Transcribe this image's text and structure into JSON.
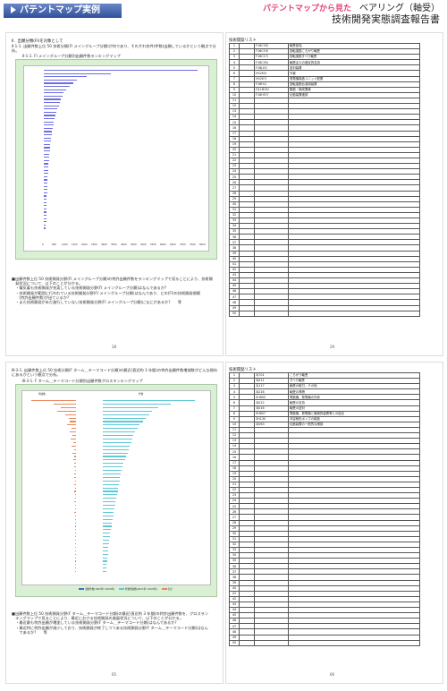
{
  "header": {
    "tag": "パテントマップ実例",
    "subtitle_pink": "パテントマップから見た",
    "subtitle_topic": "ベアリング（軸受）",
    "subtitle_report": "技術開発実態調査報告書"
  },
  "page1": {
    "heading": "Ⅱ．出願分類(FI)を対象として",
    "section": "Ⅱ-1-1. 出願件数上位 50 技術分類(FI メイングループ分類)が何であり、それぞれ何件(件数)出願しているかという観点で分析。",
    "chart_title": "Ⅱ-1-1. FI メイングループ分類別出願件数ランキングマップ",
    "body_lines": [
      "■出願件数上位 50 技術開発分野(FI メイングループ分類)の特許出願件数をランキングマップで見ることにより、技術開",
      "　発状況について、以下のことが分かる。",
      "　・電気着も技術開発が充実している技術開発分野(FI メイングループ分類)はなんであるか?",
      "　・技術開発が範囲に行われている技術開発分野(FI メイングループ分類)はなんであり、どの(FI)の技術開発規模",
      "　　(特許出願件数)が出ているか?",
      "　・また技術開発が未だ進行していない技術開発分野(FI メイングループ分類)になにがあるか?　　等"
    ],
    "page_number": "28"
  },
  "page2": {
    "table_title": "技術開発リスト",
    "rows": [
      [
        "1",
        "F16C33/",
        "軸受部品"
      ],
      [
        "2",
        "F16C19/",
        "回転運動ころがり軸受"
      ],
      [
        "3",
        "F16C17/",
        "回転運動すべり軸受"
      ],
      [
        "4",
        "F16C35/",
        "軸受またの固定的支持"
      ],
      [
        "5",
        "F16J15/",
        "密封装置"
      ],
      [
        "6",
        "H02K5/",
        "外被"
      ],
      [
        "7",
        "H02K7/",
        "発電機構造ユニット配置"
      ],
      [
        "8",
        "F16H1/",
        "回転運動伝達用装置"
      ],
      [
        "9",
        "G11B19/",
        "駆動・構成要素"
      ],
      [
        "10",
        "F16H57/",
        "伝動装置細部"
      ]
    ],
    "total_rows": 50,
    "page_number": "29"
  },
  "page3": {
    "section": "Ⅲ-3-1. 出願件数上位 50 技術分類(F ターム＿テーマコード分類)の最近(直近約 3 年間)の特許出願件数増減数がどんな傾向にあるかという観点で分析。",
    "chart_title": "Ⅲ-3-1. F ターム＿テーマコード分類別出願件数グロスランキングマップ",
    "chart_top_left": "増減数",
    "chart_top_right": "件数",
    "legend": [
      "出願件数(1993年～2020年)",
      "件数増減数(2021年～2022年)",
      "合計"
    ],
    "body_lines": [
      "■出願件数上位 50 技術開発分野(F ターム＿テーマコード分類)の最近(直近約 3 年間)の特許出願件数を、グロスラン",
      "　キングマップで見ることにより、最近における技術開発の進展状況について、以下のことが分かる。",
      "　・最近最も特許出願が増加している技術開発分野(F ターム＿テーマコード分類)はなんであるか?",
      "　・最近特に特許出願が減少しており、技術開発が終了しつつある技術開発分野(F ターム＿テーマコード分類)はなん",
      "　　であるか?　　等"
    ],
    "page_number": "65"
  },
  "page4": {
    "table_title": "技術開発リスト",
    "rows": [
      [
        "1",
        "3J701",
        "ころがり軸受"
      ],
      [
        "2",
        "3J011",
        "すべり軸受"
      ],
      [
        "3",
        "3J117",
        "軸受の取付、その他"
      ],
      [
        "4",
        "3J216",
        "軸受の潤滑"
      ],
      [
        "5",
        "5H605",
        "電動機、発電機の外枠"
      ],
      [
        "6",
        "3J012",
        "軸受の支持"
      ],
      [
        "7",
        "3J016",
        "軸受の密封"
      ],
      [
        "8",
        "5H607",
        "電動機、発電機と機械的装置等との結合"
      ],
      [
        "9",
        "3H130",
        "非容積形ポンプの構造"
      ],
      [
        "10",
        "3J063",
        "伝動装置の一般的な細部"
      ]
    ],
    "total_rows": 50,
    "page_number": "66"
  },
  "chart1_values": [
    7800,
    3400,
    2200,
    1700,
    1500,
    1300,
    1150,
    1000,
    950,
    880,
    820,
    760,
    700,
    650,
    600,
    560,
    520,
    480,
    450,
    420,
    400,
    380,
    360,
    340,
    320,
    300,
    285,
    270,
    255,
    240,
    230,
    220,
    210,
    200,
    190,
    180,
    170,
    165,
    160,
    155,
    150,
    145,
    140,
    135,
    130,
    125,
    120,
    115,
    110,
    105
  ],
  "chart1_axis": [
    "0",
    "500",
    "1000",
    "1500",
    "2000",
    "2500",
    "3000",
    "3500",
    "4000",
    "4500",
    "5000",
    "5500",
    "6000",
    "6500",
    "7000",
    "7500",
    "8000"
  ],
  "chart3_values": [
    1500,
    1100,
    900,
    800,
    750,
    700,
    650,
    600,
    560,
    520,
    500,
    480,
    460,
    440,
    420,
    400,
    380,
    360,
    340,
    320,
    300,
    290,
    280,
    270,
    260,
    250,
    240,
    230,
    220,
    210,
    200,
    190,
    180,
    170,
    160,
    150,
    140,
    130,
    120,
    110,
    100,
    95,
    90,
    85,
    80,
    75,
    70,
    65,
    60,
    55
  ],
  "chart3_delta": [
    -60,
    -30,
    -20,
    -25,
    -15,
    -10,
    -8,
    -12,
    -6,
    -9,
    -5,
    -7,
    -4,
    -6,
    -3,
    -5,
    -2,
    -4,
    -3,
    -2,
    -1,
    -2,
    -3,
    -1,
    -2,
    -1,
    -2,
    -1,
    -1,
    -2,
    -1,
    -1,
    -2,
    -1,
    -1,
    -1,
    -1,
    -1,
    -1,
    -1,
    -1,
    -1,
    -1,
    -1,
    -1,
    -1,
    -1,
    -1,
    -1,
    -1
  ],
  "colors": {
    "bar": "#6d6de0",
    "chart_bg": "#d9f0d4",
    "bar_pos": "#5fc7d6",
    "bar_neg": "#e8885f",
    "accent": "#e0447a"
  }
}
